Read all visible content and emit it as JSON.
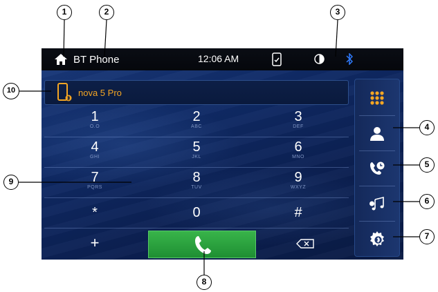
{
  "status_bar": {
    "title": "BT Phone",
    "time": "12:06 AM",
    "icons": [
      "home-icon",
      "phone-sync-icon",
      "brightness-icon",
      "bluetooth-icon"
    ]
  },
  "device": {
    "name": "nova 5 Pro",
    "icon": "phone-bluetooth-icon"
  },
  "keypad": [
    {
      "num": "1",
      "letters": "O.O"
    },
    {
      "num": "2",
      "letters": "ABC"
    },
    {
      "num": "3",
      "letters": "DEF"
    },
    {
      "num": "4",
      "letters": "GHI"
    },
    {
      "num": "5",
      "letters": "JKL"
    },
    {
      "num": "6",
      "letters": "MNO"
    },
    {
      "num": "7",
      "letters": "PQRS"
    },
    {
      "num": "8",
      "letters": "TUV"
    },
    {
      "num": "9",
      "letters": "WXYZ"
    },
    {
      "num": "*",
      "letters": ""
    },
    {
      "num": "0",
      "letters": ""
    },
    {
      "num": "#",
      "letters": ""
    }
  ],
  "bottom_row": {
    "plus": "+",
    "call_icon": "phone-call-icon",
    "backspace_icon": "backspace-icon"
  },
  "side_panel": [
    "dialpad-icon",
    "contacts-icon",
    "call-history-icon",
    "bt-music-icon",
    "bt-settings-icon"
  ],
  "callouts": [
    "1",
    "2",
    "3",
    "4",
    "5",
    "6",
    "7",
    "8",
    "9",
    "10"
  ],
  "colors": {
    "accent": "#f5a623",
    "call_green": "#2fa540",
    "screen_blue": "#0f2a66",
    "bluetooth": "#2f7bff"
  }
}
